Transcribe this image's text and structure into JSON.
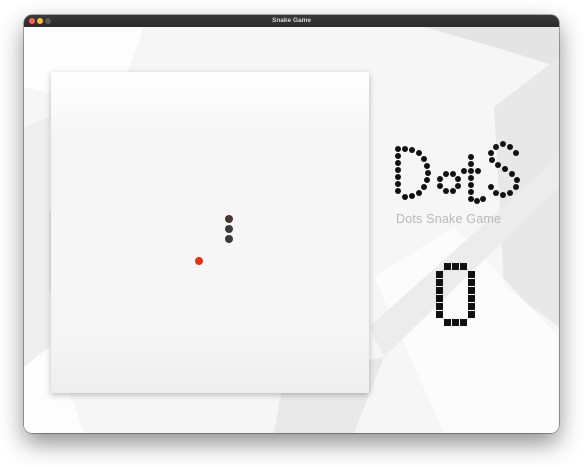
{
  "window": {
    "title": "Snake Game",
    "controls": [
      {
        "name": "close",
        "color": "#ff5f57"
      },
      {
        "name": "minimize",
        "color": "#febc2e"
      },
      {
        "name": "zoom",
        "color": "#5a5a5a"
      }
    ]
  },
  "game": {
    "logo_text": "Dots",
    "subtitle": "Dots Snake Game",
    "score": "0",
    "snake": [
      {
        "col": 16,
        "row": 13
      },
      {
        "col": 16,
        "row": 14
      },
      {
        "col": 16,
        "row": 15
      }
    ],
    "food": {
      "col": 13,
      "row": 17
    },
    "colors": {
      "snake": "#3a3a3a",
      "snake_head": "#4a3430",
      "food": "#e8300e",
      "logo_dots": "#111111",
      "subtitle": "#b8b8b8"
    }
  }
}
